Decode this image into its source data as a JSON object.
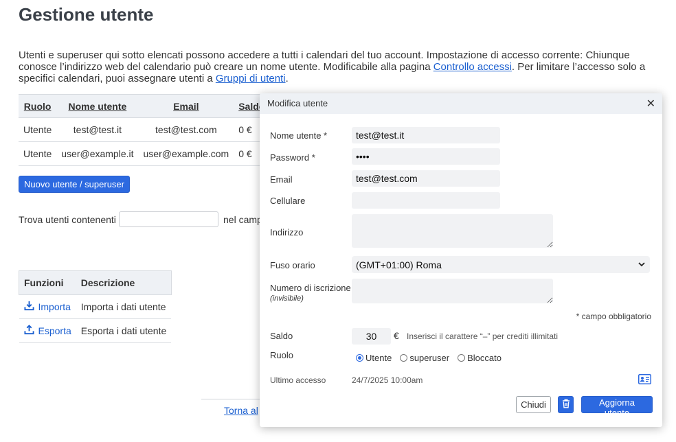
{
  "page": {
    "title": "Gestione utente",
    "intro": {
      "part1": "Utenti e superuser qui sotto elencati possono accedere a tutti i calendari del tuo account. Impostazione di accesso corrente: Chiunque conosce l’indirizzo web del calendario può creare un nome utente. Modificabile alla pagina ",
      "link1": "Controllo accessi",
      "part2": ". Per limitare l’accesso solo a specifici calendari, puoi assegnare utenti a ",
      "link2": "Gruppi di utenti",
      "part3": "."
    }
  },
  "users_table": {
    "headers": [
      "Ruolo",
      "Nome utente",
      "Email",
      "Saldo"
    ],
    "rows": [
      {
        "role": "Utente",
        "username": "test@test.it",
        "email": "test@test.com",
        "balance": "0 €"
      },
      {
        "role": "Utente",
        "username": "user@example.it",
        "email": "user@example.com",
        "balance": "0 €"
      }
    ]
  },
  "new_user_button": "Nuovo utente / superuser",
  "search": {
    "label": "Trova utenti contenenti",
    "value": "",
    "field_label": "nel camp"
  },
  "functions_table": {
    "headers": [
      "Funzioni",
      "Descrizione"
    ],
    "rows": [
      {
        "icon": "download-icon",
        "name": "Importa",
        "description": "Importa i dati utente"
      },
      {
        "icon": "upload-icon",
        "name": "Esporta",
        "description": "Esporta i dati utente"
      }
    ]
  },
  "back_link": "Torna al",
  "modal": {
    "title": "Modifica utente",
    "close": "✕",
    "fields": {
      "username": {
        "label": "Nome utente *",
        "value": "test@test.it"
      },
      "password": {
        "label": "Password *",
        "value": "••••"
      },
      "email": {
        "label": "Email",
        "value": "test@test.com"
      },
      "mobile": {
        "label": "Cellulare",
        "value": ""
      },
      "address": {
        "label": "Indirizzo",
        "value": ""
      },
      "timezone": {
        "label": "Fuso orario",
        "value": "(GMT+01:00) Roma"
      },
      "registration": {
        "label": "Numero di iscrizione",
        "sublabel": "(invisibile)",
        "value": ""
      }
    },
    "required_note": "* campo obbligatorio",
    "balance": {
      "label": "Saldo",
      "value": "30",
      "currency": "€",
      "hint": "Inserisci il carattere “–” per crediti illimitati"
    },
    "role": {
      "label": "Ruolo",
      "options": [
        "Utente",
        "superuser",
        "Bloccato"
      ],
      "selected": "Utente"
    },
    "last_access": {
      "label": "Ultimo accesso",
      "value": "24/7/2025 10:00am"
    },
    "buttons": {
      "close": "Chiudi",
      "delete_icon": "trash-icon",
      "update": "Aggiorna utente"
    }
  },
  "colors": {
    "accent": "#2c69e0",
    "link": "#1a5fd0",
    "header_bg": "#eef1f5",
    "input_bg": "#f1f2f4"
  }
}
